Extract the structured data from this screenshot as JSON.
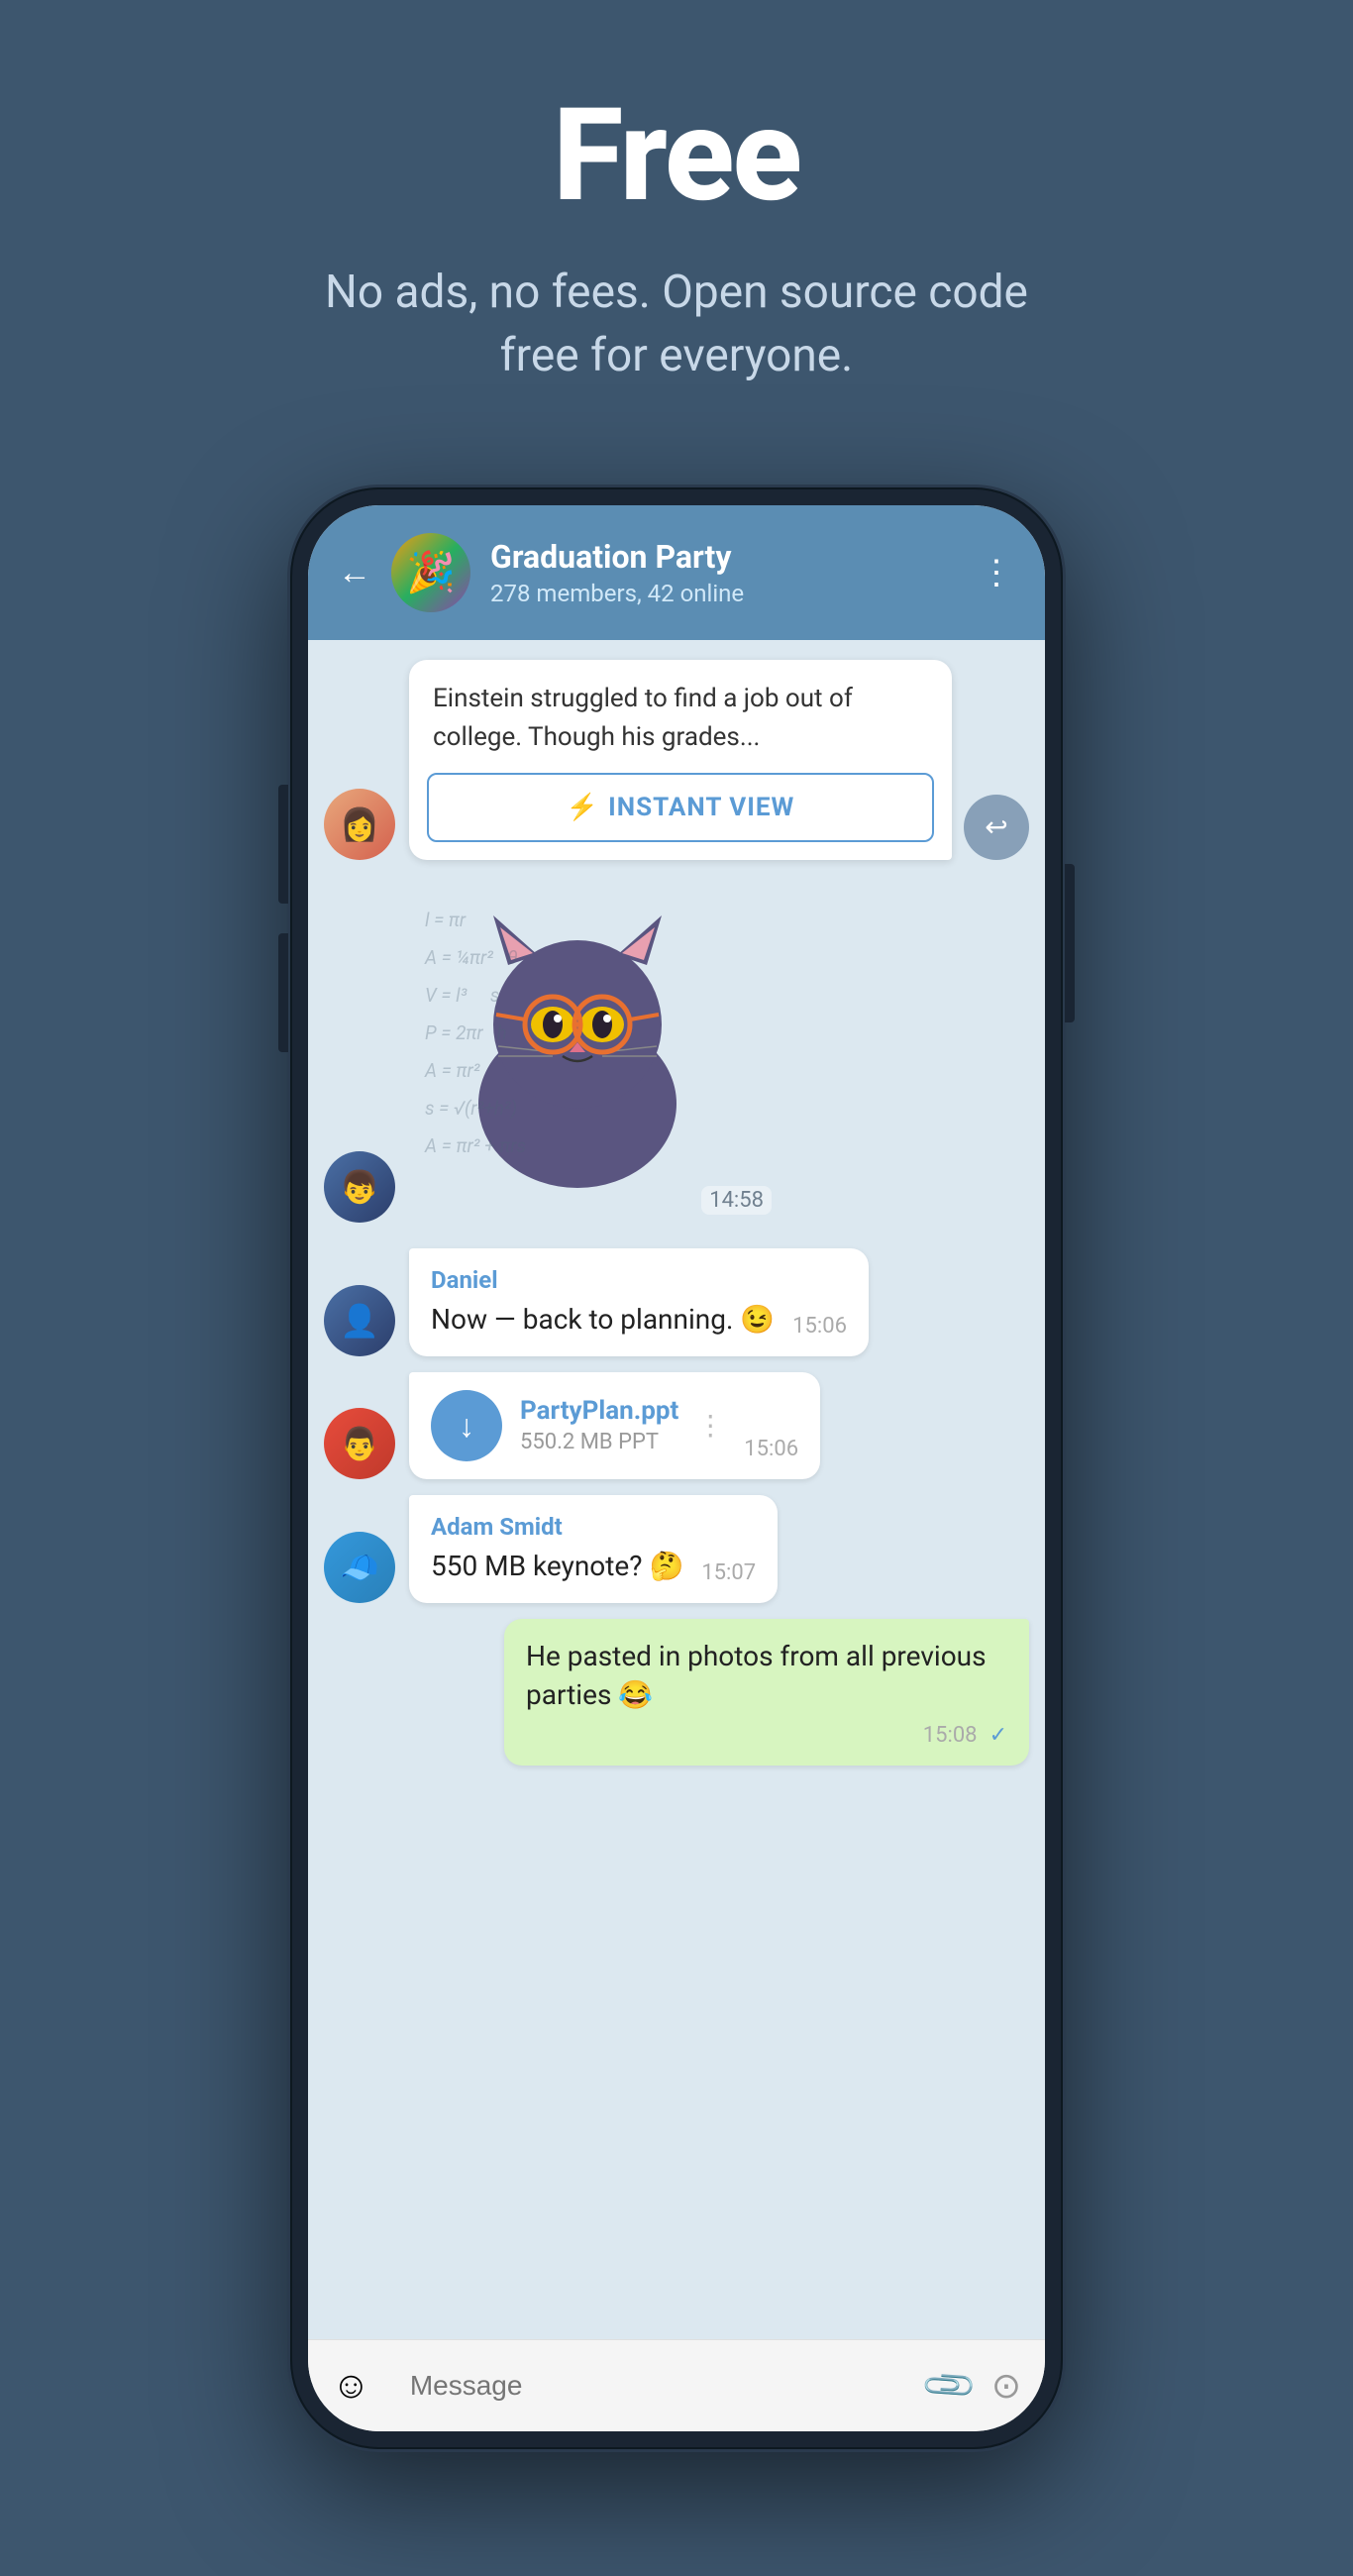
{
  "hero": {
    "title": "Free",
    "subtitle": "No ads, no fees. Open source code free for everyone."
  },
  "chat": {
    "back_label": "←",
    "group_name": "Graduation Party",
    "group_members": "278 members, 42 online",
    "more_icon": "⋮",
    "article": {
      "text": "Einstein struggled to find a job out of college. Though his grades...",
      "instant_view_label": "INSTANT VIEW",
      "instant_view_icon": "⚡"
    },
    "sticker_time": "14:58",
    "messages": [
      {
        "sender": "Daniel",
        "text": "Now — back to planning. 😉",
        "time": "15:06",
        "type": "received"
      },
      {
        "file_name": "PartyPlan.ppt",
        "file_size": "550.2 MB PPT",
        "time": "15:06",
        "type": "file"
      },
      {
        "sender": "Adam Smidt",
        "text": "550 MB keynote? 🤔",
        "time": "15:07",
        "type": "received"
      },
      {
        "text": "He pasted in photos from all previous parties 😂",
        "time": "15:08",
        "type": "sent",
        "check": "✓"
      }
    ],
    "input": {
      "placeholder": "Message",
      "emoji_icon": "☺",
      "attach_icon": "📎",
      "camera_icon": "◎"
    }
  }
}
